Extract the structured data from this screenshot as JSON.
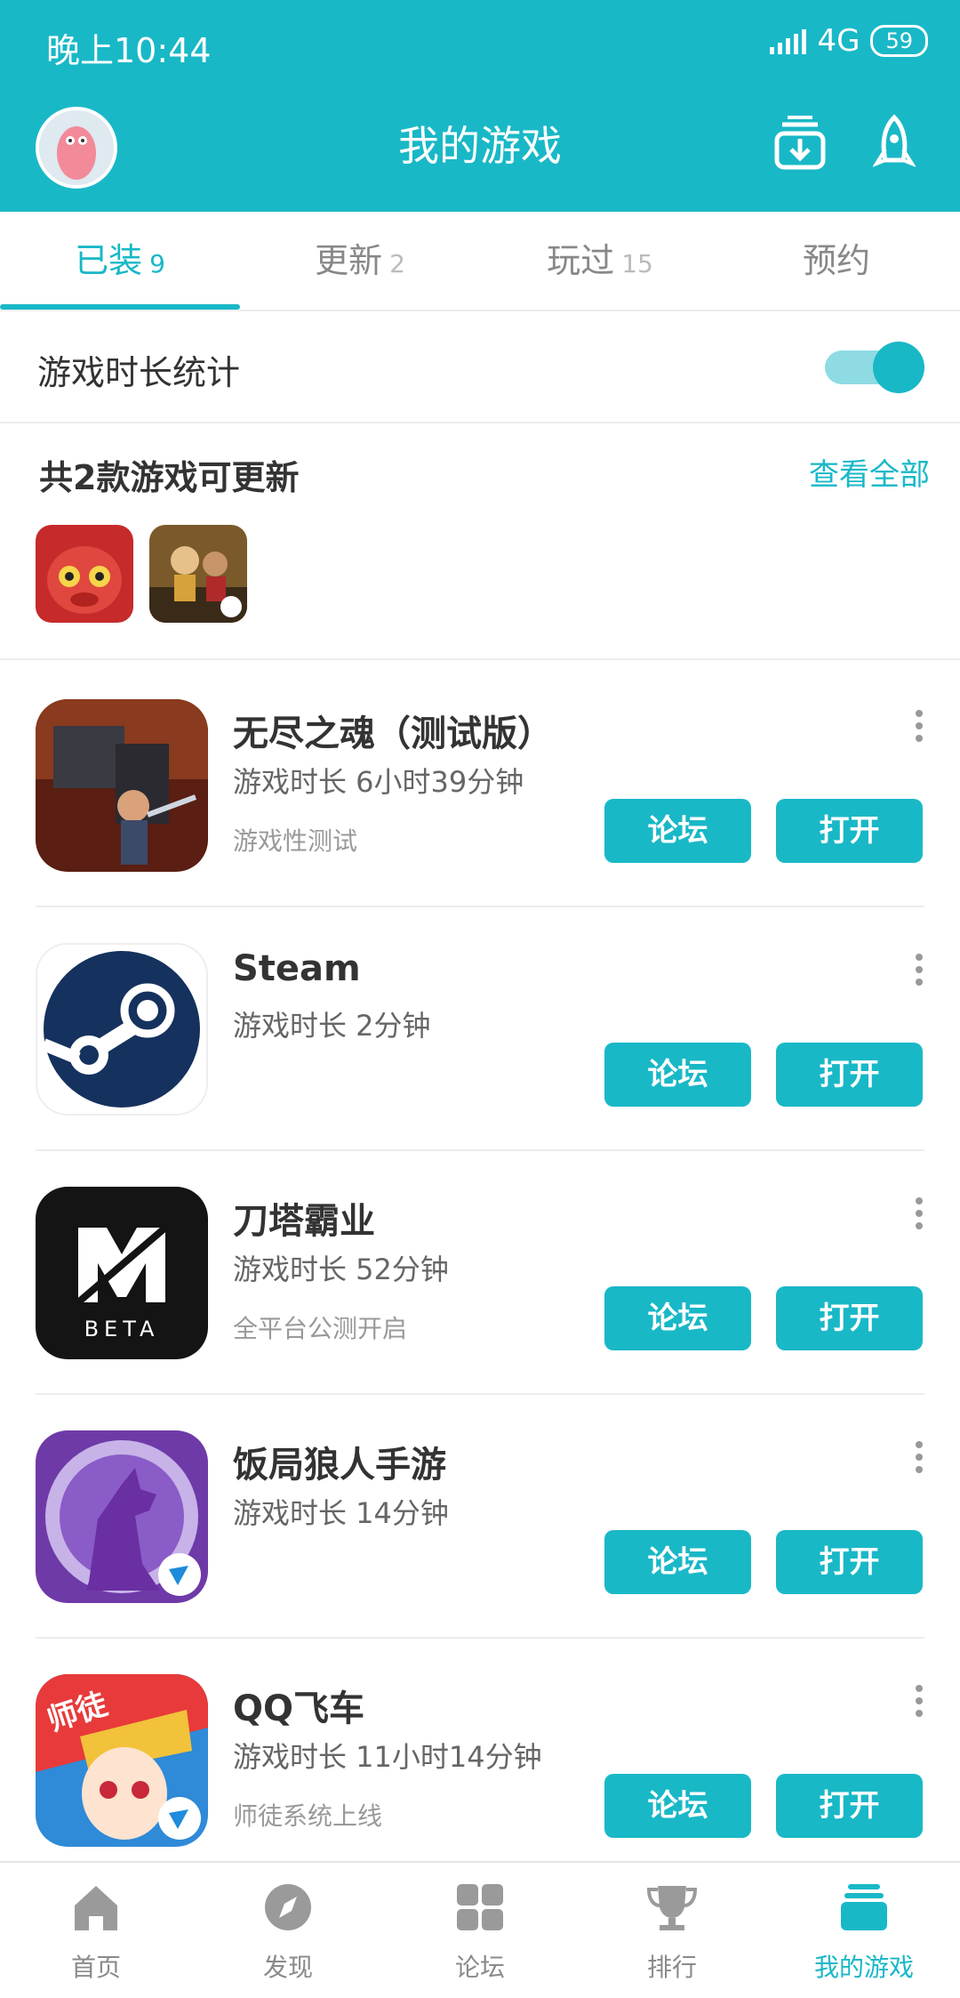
{
  "status_bar": {
    "time": "晚上10:44",
    "network": "4G",
    "battery": "59"
  },
  "header": {
    "title": "我的游戏"
  },
  "tabs": [
    {
      "label": "已装",
      "count": "9"
    },
    {
      "label": "更新",
      "count": "2"
    },
    {
      "label": "玩过",
      "count": "15"
    },
    {
      "label": "预约",
      "count": ""
    }
  ],
  "stats": {
    "label": "游戏时长统计",
    "enabled": true
  },
  "updates": {
    "title": "共2款游戏可更新",
    "view_all": "查看全部"
  },
  "games": [
    {
      "name": "无尽之魂（测试版）",
      "time": "游戏时长 6小时39分钟",
      "note": "游戏性测试",
      "forum": "论坛",
      "open": "打开"
    },
    {
      "name": "Steam",
      "time": "游戏时长 2分钟",
      "note": "",
      "forum": "论坛",
      "open": "打开"
    },
    {
      "name": "刀塔霸业",
      "time": "游戏时长 52分钟",
      "note": "全平台公测开启",
      "forum": "论坛",
      "open": "打开"
    },
    {
      "name": "饭局狼人手游",
      "time": "游戏时长 14分钟",
      "note": "",
      "forum": "论坛",
      "open": "打开"
    },
    {
      "name": "QQ飞车",
      "time": "游戏时长 11小时14分钟",
      "note": "师徒系统上线",
      "forum": "论坛",
      "open": "打开"
    }
  ],
  "icon_text": {
    "beta": "BETA",
    "shitu": "师徒"
  },
  "bottom_nav": [
    {
      "label": "首页",
      "icon": "home-icon"
    },
    {
      "label": "发现",
      "icon": "compass-icon"
    },
    {
      "label": "论坛",
      "icon": "grid-icon"
    },
    {
      "label": "排行",
      "icon": "trophy-icon"
    },
    {
      "label": "我的游戏",
      "icon": "stack-icon",
      "active": true
    }
  ],
  "colors": {
    "accent": "#19b8c7",
    "accent_light": "#8fdbe3"
  }
}
